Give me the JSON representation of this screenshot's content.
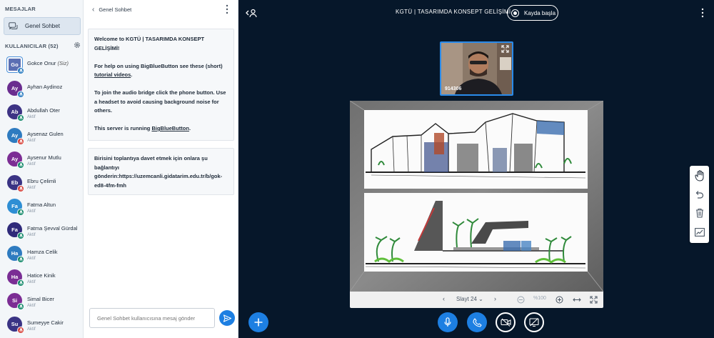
{
  "sidebar": {
    "messages_title": "MESAJLAR",
    "public_chat_label": "Genel Sohbet",
    "users_title": "KULLANICILAR (52)",
    "users": [
      {
        "initials": "Go",
        "name": "Gokce Onur",
        "suffix": "(Siz)",
        "status": "",
        "color": "#5b6fb3",
        "badge": "#2d7ec2",
        "presenter": true
      },
      {
        "initials": "Ay",
        "name": "Ayhan Aydinoz",
        "suffix": "",
        "status": "",
        "color": "#6a2d8f",
        "badge": "#2d7ec2",
        "presenter": false
      },
      {
        "initials": "Ab",
        "name": "Abdullah Oter",
        "suffix": "",
        "status": "Aktif",
        "color": "#3d3384",
        "badge": "#158a6a",
        "presenter": false
      },
      {
        "initials": "Ay",
        "name": "Aysenaz Gulen",
        "suffix": "",
        "status": "Aktif",
        "color": "#2e7bc0",
        "badge": "#d9453d",
        "presenter": false
      },
      {
        "initials": "Ay",
        "name": "Aysenur Mutlu",
        "suffix": "",
        "status": "Aktif",
        "color": "#7c2d94",
        "badge": "#158a6a",
        "presenter": false
      },
      {
        "initials": "Eb",
        "name": "Ebru Çelimli",
        "suffix": "",
        "status": "Aktif",
        "color": "#3a3384",
        "badge": "#d9453d",
        "presenter": false
      },
      {
        "initials": "Fa",
        "name": "Fatma Altun",
        "suffix": "",
        "status": "Aktif",
        "color": "#2e8ed4",
        "badge": "#158a6a",
        "presenter": false
      },
      {
        "initials": "Fa",
        "name": "Fatma Şevval Gürdal",
        "suffix": "",
        "status": "Aktif",
        "color": "#2f2a7a",
        "badge": "#158a6a",
        "presenter": false
      },
      {
        "initials": "Ha",
        "name": "Hamza Celik",
        "suffix": "",
        "status": "Aktif",
        "color": "#2e7bc0",
        "badge": "#158a6a",
        "presenter": false
      },
      {
        "initials": "Ha",
        "name": "Hatice Kinik",
        "suffix": "",
        "status": "Aktif",
        "color": "#7a2d94",
        "badge": "#158a6a",
        "presenter": false
      },
      {
        "initials": "Si",
        "name": "Simal Bicer",
        "suffix": "",
        "status": "Aktif",
        "color": "#7c2d94",
        "badge": "#158a6a",
        "presenter": false
      },
      {
        "initials": "Su",
        "name": "Sumeyye Cakir",
        "suffix": "",
        "status": "Aktif",
        "color": "#3a3384",
        "badge": "#d9453d",
        "presenter": false
      }
    ]
  },
  "chat": {
    "header": "Genel Sohbet",
    "welcome": {
      "line1_prefix": "Welcome to ",
      "line1_title": "KGTÜ | TASARIMDA KONSEPT GELİŞİMİ",
      "line1_suffix": "!",
      "help_prefix": "For help on using BigBlueButton see these (short) ",
      "help_link": "tutorial videos",
      "help_suffix": ".",
      "audio": "To join the audio bridge click the phone button. Use a headset to avoid causing background noise for others.",
      "server_prefix": "This server is running ",
      "server_link": "BigBlueButton",
      "server_suffix": "."
    },
    "invite": "Birisini toplantıya davet etmek için onlara şu bağlantıyı gönderin:https://uzemcanli.gidatarim.edu.tr/b/gok-ed8-4fm-fmh",
    "input_placeholder": "Genel Sohbet kullanıcısına mesaj gönder"
  },
  "main": {
    "meeting_title": "KGTÜ | TASARIMDA KONSEPT GELİŞİMİ",
    "record_label": "Kayda başla",
    "webcam_name": "914306",
    "slide_label": "Slayt 24",
    "zoom_label": "%100"
  },
  "colors": {
    "accent": "#1d7fe2",
    "background": "#06172a"
  }
}
